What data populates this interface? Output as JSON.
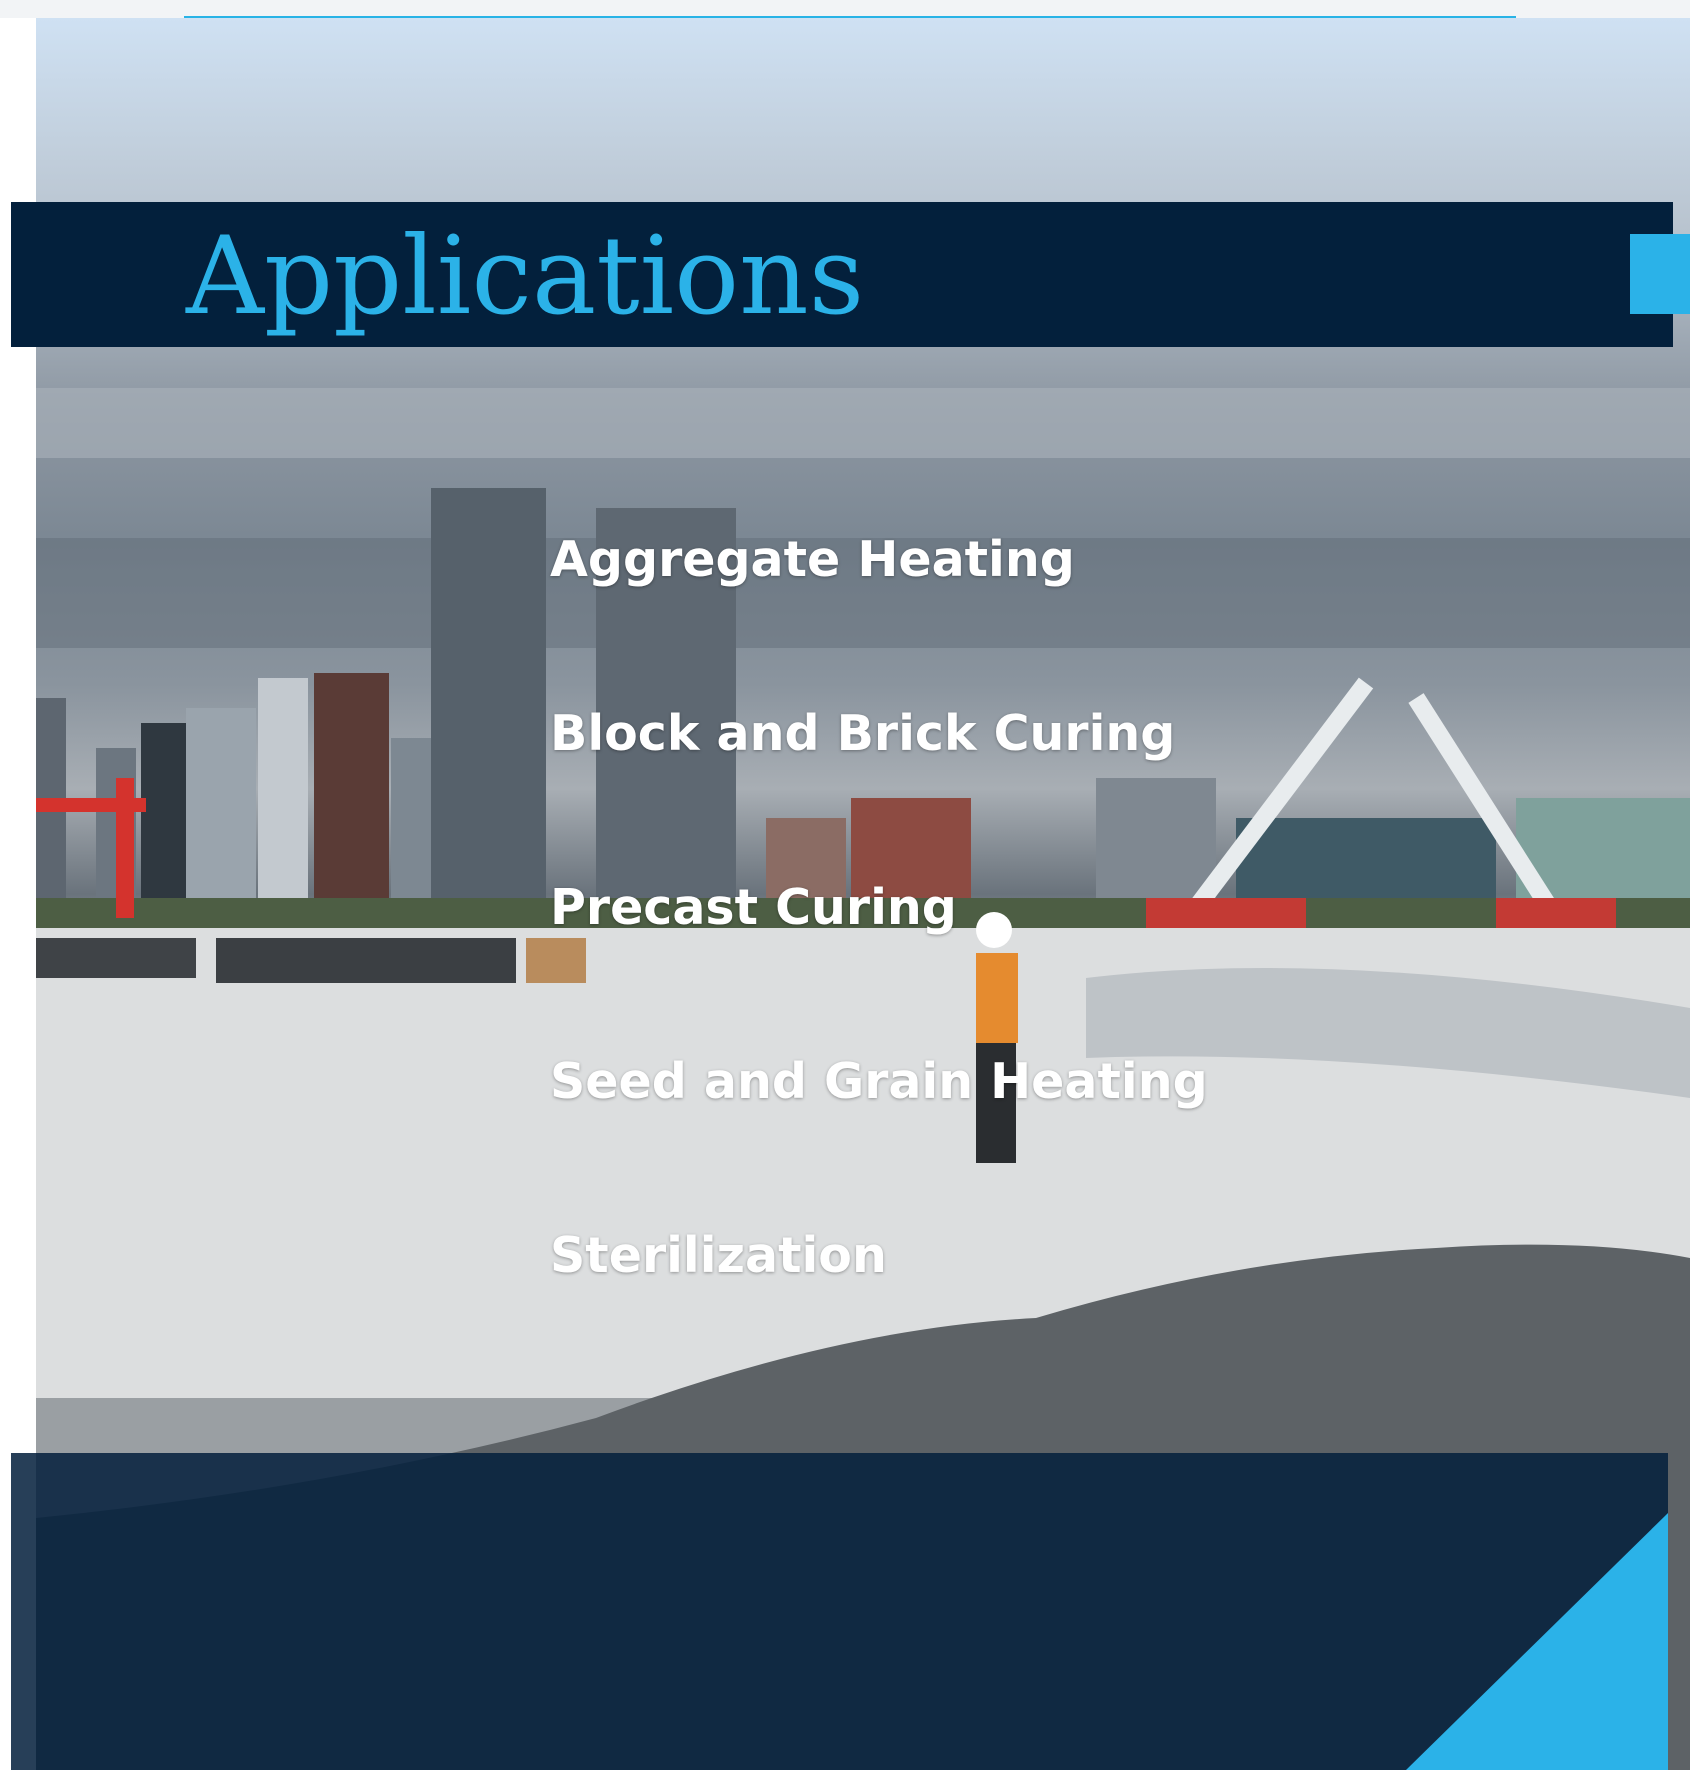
{
  "section": {
    "title": "Applications"
  },
  "applications": [
    {
      "label": "Aggregate Heating"
    },
    {
      "label": "Block and Brick Curing"
    },
    {
      "label": "Precast Curing"
    },
    {
      "label": "Seed and Grain Heating"
    },
    {
      "label": "Sterilization"
    }
  ],
  "colors": {
    "navy": "#03203c",
    "accent_blue": "#2bb2e8",
    "item_text": "#ffffff"
  },
  "background_image": {
    "subject": "construction-site-city-skyline-photo"
  },
  "icons": {
    "accent_square": "accent-square-icon",
    "footer_triangle": "corner-triangle-icon"
  }
}
